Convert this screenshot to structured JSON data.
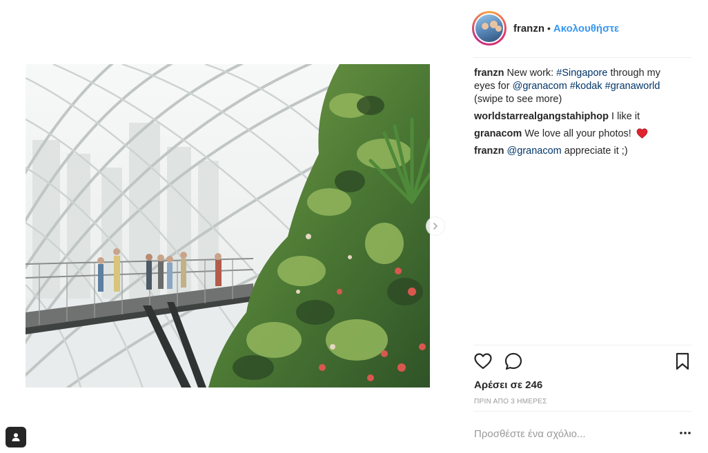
{
  "post": {
    "username": "franzn",
    "separator": "•",
    "follow_label": "Ακολουθήστε"
  },
  "caption": {
    "username": "franzn",
    "text_1": " New work: ",
    "tag_singapore": "#Singapore",
    "text_2": " through my eyes for ",
    "mention_granacom": "@granacom",
    "tag_kodak": "#kodak",
    "tag_granaworld": "#granaworld",
    "text_3": "(swipe to see more)"
  },
  "comments": [
    {
      "username": "worldstarrealgangstahiphop",
      "text": "I like it"
    },
    {
      "username": "granacom",
      "text": "We love all your photos!"
    },
    {
      "username": "franzn",
      "mention": "@granacom",
      "text": "appreciate it ;)"
    }
  ],
  "likes_text": "Αρέσει σε 246",
  "time_ago": "ΠΡΙΝ ΑΠΟ 3 ΗΜΕΡΕΣ",
  "comment_input": {
    "placeholder": "Προσθέστε ένα σχόλιο..."
  },
  "icons": {
    "like": "heart-outline-icon",
    "comment": "speech-bubble-icon",
    "save": "bookmark-icon",
    "more": "ellipsis-icon",
    "next": "chevron-right-icon",
    "tag": "user-tag-icon",
    "heart_emoji": "red-heart-icon"
  },
  "colors": {
    "link_blue": "#3897f0",
    "mention_navy": "#003569",
    "muted_gray": "#999999",
    "heart_red": "#ed4956"
  }
}
